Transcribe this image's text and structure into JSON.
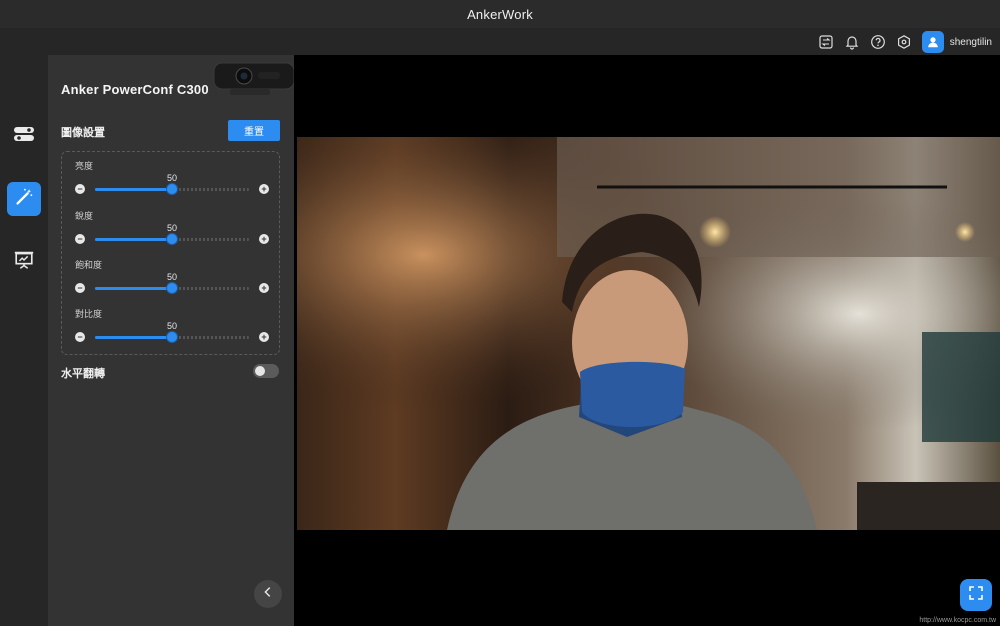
{
  "app": {
    "title": "AnkerWork"
  },
  "user": {
    "name": "shengtilin"
  },
  "topbar_icons": [
    "switch-icon",
    "bell-icon",
    "help-icon",
    "settings-icon"
  ],
  "nav": [
    {
      "icon": "toggles-icon",
      "active": false
    },
    {
      "icon": "magic-wand-icon",
      "active": true
    },
    {
      "icon": "presentation-icon",
      "active": false
    }
  ],
  "panel": {
    "device_name": "Anker PowerConf C300",
    "section_title": "圖像設置",
    "reset_label": "重置",
    "sliders": [
      {
        "label": "亮度",
        "value": "50",
        "fraction": 0.5
      },
      {
        "label": "銳度",
        "value": "50",
        "fraction": 0.5
      },
      {
        "label": "飽和度",
        "value": "50",
        "fraction": 0.5
      },
      {
        "label": "對比度",
        "value": "50",
        "fraction": 0.5
      }
    ],
    "flip_label": "水平翻轉",
    "flip_on": false
  },
  "colors": {
    "accent": "#2d8cf0",
    "panel": "#333333",
    "background": "#1e1e1e"
  },
  "watermark": "http://www.kocpc.com.tw"
}
